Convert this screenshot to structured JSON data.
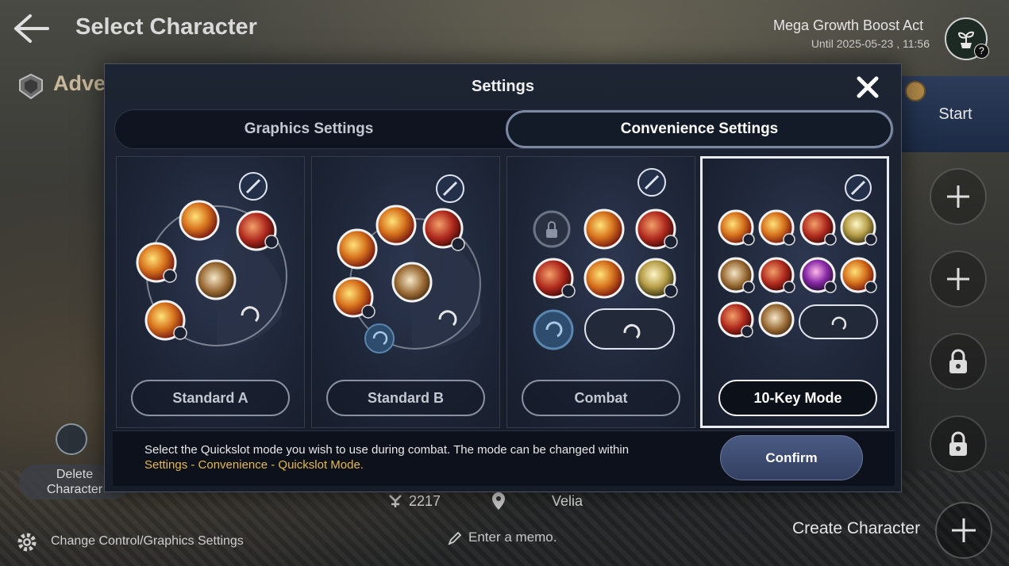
{
  "header": {
    "title": "Select Character",
    "boost_name": "Mega Growth Boost Act",
    "boost_until": "Until 2025-05-23 , 11:56",
    "help": "?"
  },
  "adventurer": {
    "label": "Adve"
  },
  "start": {
    "label": "Start"
  },
  "side_slots": [
    {
      "type": "add"
    },
    {
      "type": "add"
    },
    {
      "type": "locked"
    },
    {
      "type": "locked"
    }
  ],
  "character": {
    "delete_label": "Delete\nCharacter",
    "combat_power": "2217",
    "location": "Velia",
    "memo_placeholder": "Enter a memo."
  },
  "bottom": {
    "change_control": "Change Control/Graphics Settings",
    "create_character": "Create Character"
  },
  "modal": {
    "title": "Settings",
    "tabs": [
      {
        "label": "Graphics Settings",
        "active": false
      },
      {
        "label": "Convenience Settings",
        "active": true
      }
    ],
    "modes": [
      {
        "label": "Standard A",
        "selected": false
      },
      {
        "label": "Standard B",
        "selected": false
      },
      {
        "label": "Combat",
        "selected": false
      },
      {
        "label": "10-Key Mode",
        "selected": true
      }
    ],
    "footer_text": "Select the Quickslot mode you wish to use during combat. The mode can be changed within",
    "footer_link": "Settings - Convenience - Quickslot Mode.",
    "confirm_label": "Confirm"
  },
  "colors": {
    "accent_gold": "#e8b84a",
    "modal_bg": "#1d2433",
    "confirm_bg": "#4a5a82"
  }
}
